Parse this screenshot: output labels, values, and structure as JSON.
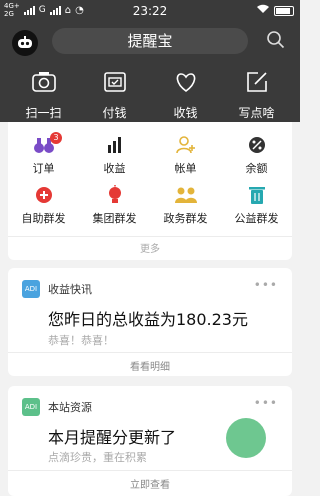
{
  "status_bar": {
    "network_top": "4G+",
    "network_bottom": "2G",
    "carrier": "G",
    "time": "23:22"
  },
  "header": {
    "title": "提醒宝"
  },
  "quick_actions": [
    {
      "label": "扫一扫",
      "icon": "scan-icon"
    },
    {
      "label": "付钱",
      "icon": "pay-icon"
    },
    {
      "label": "收钱",
      "icon": "heart-icon"
    },
    {
      "label": "写点啥",
      "icon": "edit-icon"
    }
  ],
  "grid": {
    "items": [
      {
        "label": "订单",
        "icon": "binoculars-icon",
        "color": "#7a4cc7",
        "badge": "3"
      },
      {
        "label": "收益",
        "icon": "bar-chart-icon",
        "color": "#222222"
      },
      {
        "label": "帐单",
        "icon": "person-add-icon",
        "color": "#e3b43a"
      },
      {
        "label": "余额",
        "icon": "percent-icon",
        "color": "#333333"
      },
      {
        "label": "自助群发",
        "icon": "plus-circle-icon",
        "color": "#e53935"
      },
      {
        "label": "集团群发",
        "icon": "bulb-icon",
        "color": "#e53935"
      },
      {
        "label": "政务群发",
        "icon": "group-icon",
        "color": "#e3b43a"
      },
      {
        "label": "公益群发",
        "icon": "trash-icon",
        "color": "#26a8b0"
      }
    ],
    "more": "更多"
  },
  "cards": [
    {
      "tag": "ADI",
      "tag_color": "#4aa3df",
      "title": "收益快讯",
      "dots": "•••",
      "headline": "您昨日的总收益为180.23元",
      "subline": "恭喜！恭喜！",
      "action": "看看明细"
    },
    {
      "tag": "ADI",
      "tag_color": "#5cc08a",
      "title": "本站资源",
      "dots": "•••",
      "headline": "本月提醒分更新了",
      "subline": "点滴珍贵，重在积累",
      "action": "立即查看"
    }
  ]
}
